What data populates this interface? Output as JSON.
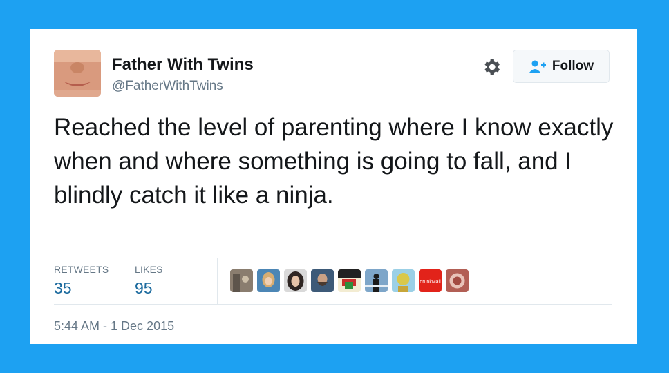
{
  "user": {
    "name": "Father With Twins",
    "handle": "@FatherWithTwins"
  },
  "follow_button": {
    "label": "Follow",
    "icon": "add-user-icon"
  },
  "settings": {
    "icon": "gear-icon"
  },
  "tweet": {
    "text": "Reached the level of parenting where I know exactly when and where something is going to fall, and I blindly catch it like a ninja."
  },
  "stats": {
    "retweets_label": "RETWEETS",
    "retweets_count": "35",
    "likes_label": "LIKES",
    "likes_count": "95"
  },
  "liker_avatars": [
    {
      "color": "#8a7d6f"
    },
    {
      "color": "#c9a77a"
    },
    {
      "color": "#5b4d45"
    },
    {
      "color": "#4e5a66"
    },
    {
      "color": "#e6d7a8"
    },
    {
      "color": "#6f8cb0"
    },
    {
      "color": "#d9c84a"
    },
    {
      "color": "#e2231a",
      "text": "drunkMail"
    },
    {
      "color": "#b25f55"
    }
  ],
  "timestamp": "5:44 AM - 1 Dec 2015",
  "colors": {
    "background": "#1da1f2",
    "text": "#14171a",
    "muted": "#657786",
    "count": "#1b6a9e"
  }
}
